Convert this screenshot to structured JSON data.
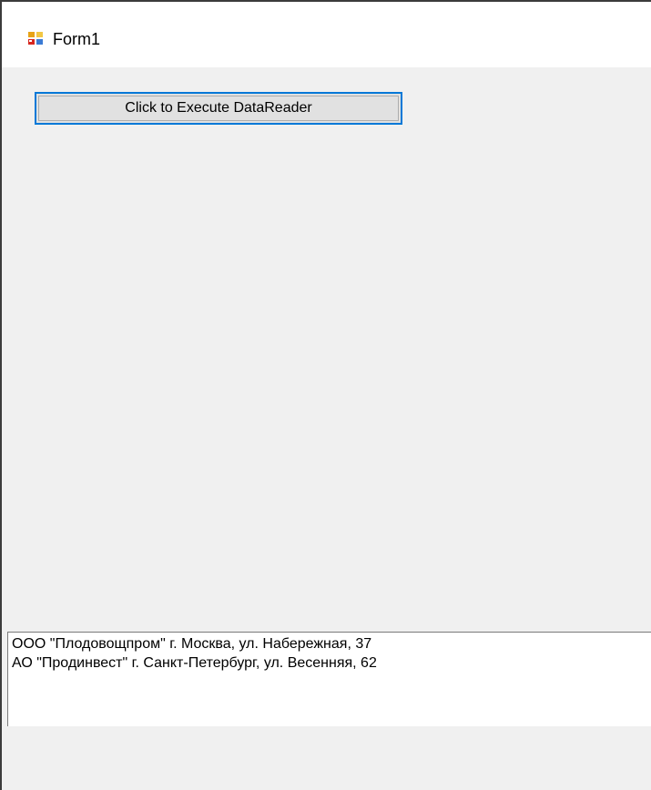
{
  "window": {
    "title": "Form1",
    "icon": "winforms-app-icon"
  },
  "main": {
    "execute_button_label": "Click to Execute DataReader"
  },
  "output": {
    "lines": [
      "ООО \"Плодовощпром\" г. Москва, ул. Набережная, 37",
      "АО \"Продинвест\" г. Санкт-Петербург, ул. Весенняя, 62"
    ]
  }
}
